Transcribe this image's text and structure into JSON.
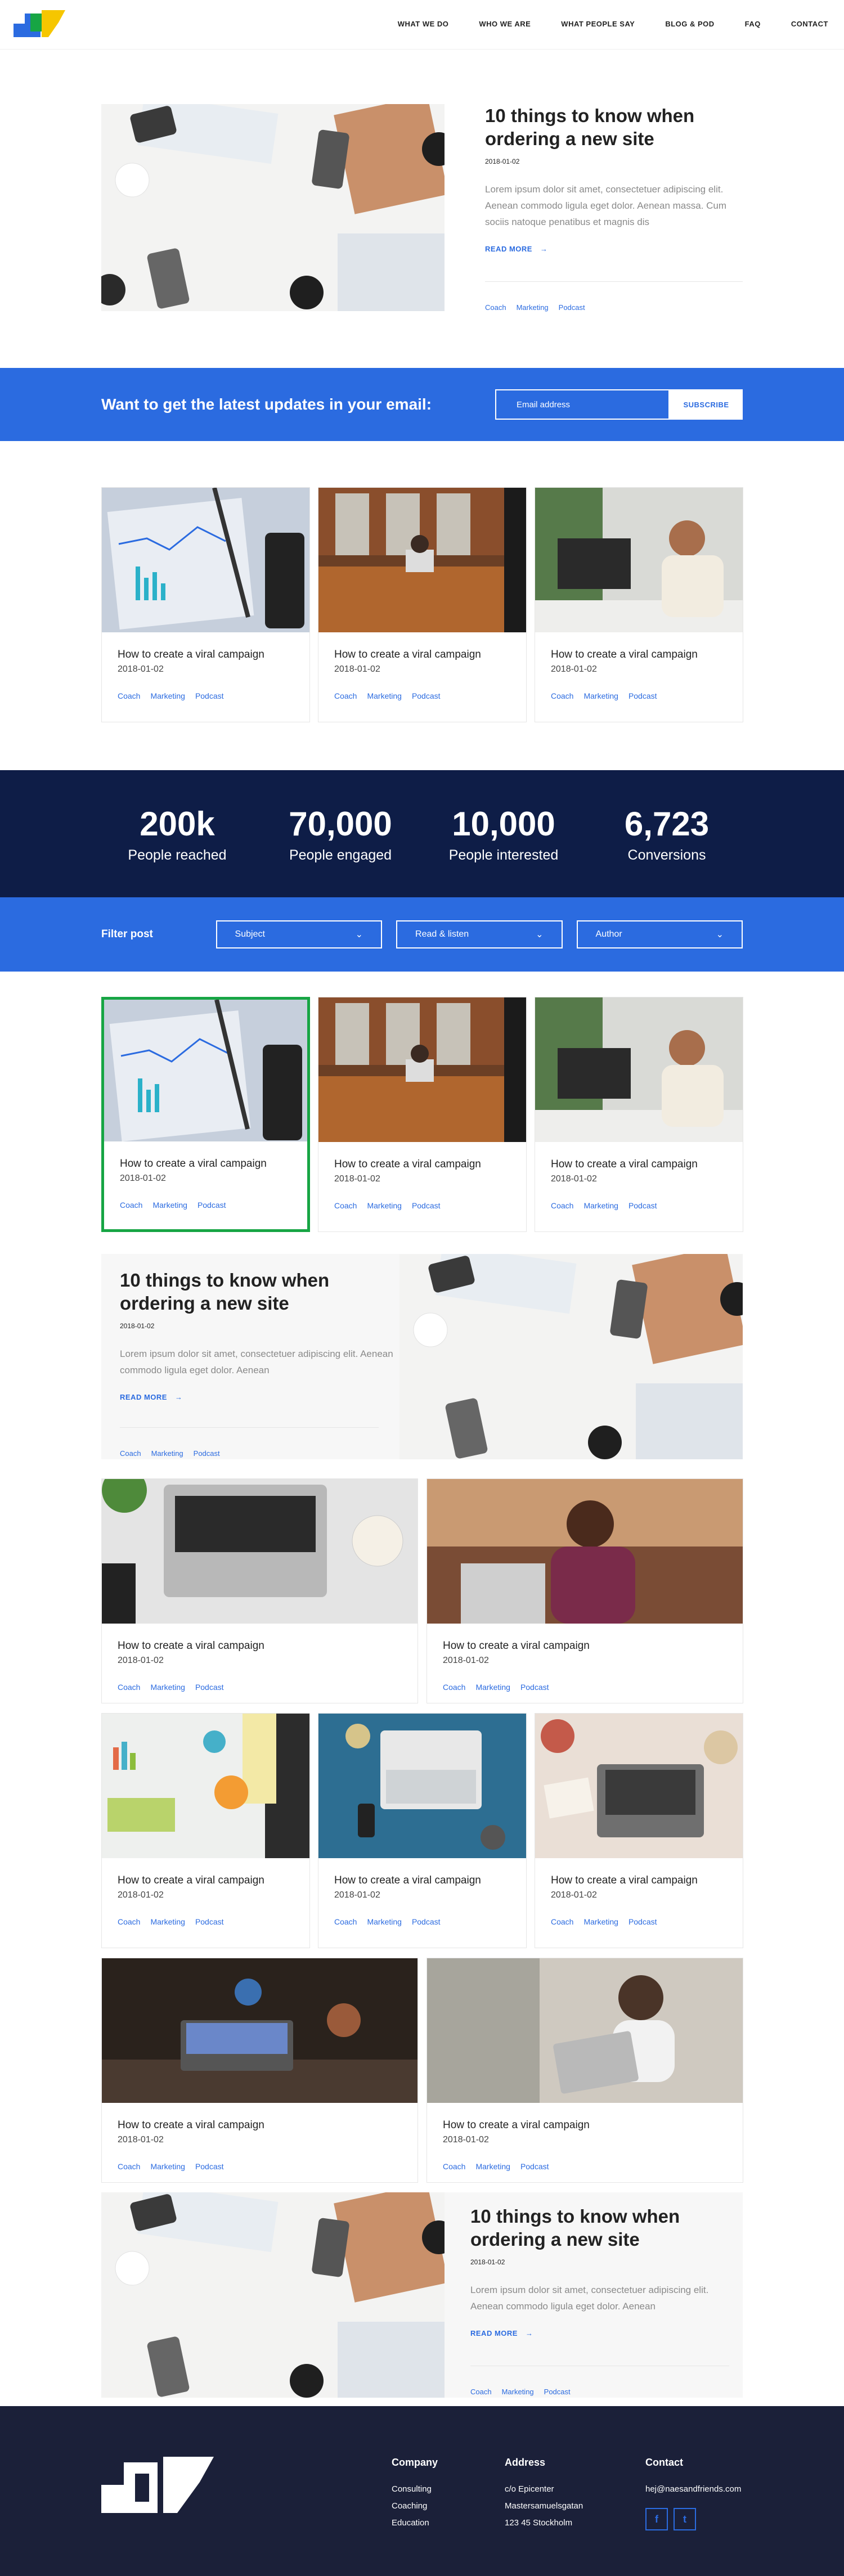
{
  "nav": [
    "WHAT WE DO",
    "WHO WE ARE",
    "WHAT PEOPLE SAY",
    "BLOG & POD",
    "FAQ",
    "CONTACT"
  ],
  "feature": {
    "title": "10 things to know when ordering a new site",
    "date": "2018-01-02",
    "body": "Lorem ipsum dolor sit amet, consectetuer adipiscing elit. Aenean commodo ligula eget dolor. Aenean massa. Cum sociis natoque penatibus et magnis dis",
    "read_more": "READ MORE",
    "tags": [
      "Coach",
      "Marketing",
      "Podcast"
    ]
  },
  "newsletter": {
    "title": "Want to get the latest updates in your email:",
    "placeholder": "Email address",
    "button": "SUBSCRIBE"
  },
  "card": {
    "title": "How to create a viral campaign",
    "date": "2018-01-02",
    "tags": [
      "Coach",
      "Marketing",
      "Podcast"
    ]
  },
  "stats": [
    {
      "num": "200k",
      "label": "People reached"
    },
    {
      "num": "70,000",
      "label": "People engaged"
    },
    {
      "num": "10,000",
      "label": "People interested"
    },
    {
      "num": "6,723",
      "label": "Conversions"
    }
  ],
  "filter": {
    "label": "Filter post",
    "selects": [
      "Subject",
      "Read & listen",
      "Author"
    ]
  },
  "promo": {
    "title": "10 things to know when ordering a new site",
    "date": "2018-01-02",
    "body": "Lorem ipsum dolor sit amet, consectetuer adipiscing elit. Aenean commodo ligula eget dolor. Aenean",
    "read_more": "READ MORE",
    "tags": [
      "Coach",
      "Marketing",
      "Podcast"
    ]
  },
  "footer": {
    "company": {
      "title": "Company",
      "items": [
        "Consulting",
        "Coaching",
        "Education"
      ]
    },
    "address": {
      "title": "Address",
      "items": [
        "c/o Epicenter",
        "Mastersamuelsgatan",
        "123 45 Stockholm"
      ]
    },
    "contact": {
      "title": "Contact",
      "email": "hej@naesandfriends.com"
    },
    "social": [
      "f",
      "t"
    ]
  },
  "colors": {
    "accent": "#2b6be0",
    "dark": "#0e1d47",
    "footer": "#1b2039",
    "selected": "#17a544"
  }
}
